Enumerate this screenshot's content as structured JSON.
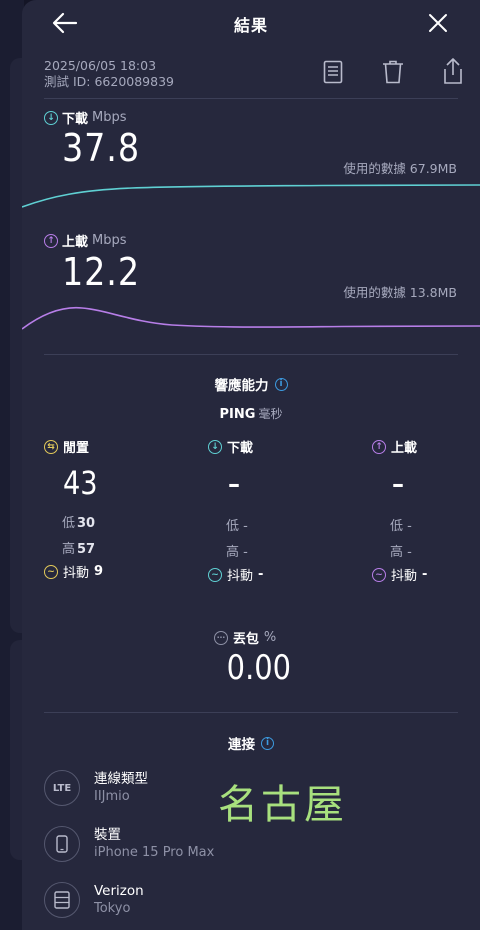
{
  "header": {
    "title": "結果",
    "back_icon": "arrow-left-icon",
    "close_icon": "close-icon"
  },
  "meta": {
    "datetime": "2025/06/05 18:03",
    "test_id": "測試 ID: 6620089839"
  },
  "toolbar": {
    "icons": [
      "document-icon",
      "trash-icon",
      "share-icon"
    ]
  },
  "download": {
    "label": "下載",
    "unit": "Mbps",
    "value": "37.8",
    "used": "使用的數據 67.9MB",
    "color": "#5fd0d3"
  },
  "upload": {
    "label": "上載",
    "unit": "Mbps",
    "value": "12.2",
    "used": "使用的數據 13.8MB",
    "color": "#b77ee8"
  },
  "responsiveness": {
    "title": "響應能力",
    "ping_label": "PING",
    "ping_unit": "毫秒",
    "columns": [
      {
        "label": "閒置",
        "value": "43",
        "low_label": "低",
        "low": "30",
        "high_label": "高",
        "high": "57",
        "jitter_label": "抖動",
        "jitter": "9",
        "color": "#e2c95a"
      },
      {
        "label": "下載",
        "value": "–",
        "low_label": "低",
        "low": "-",
        "high_label": "高",
        "high": "-",
        "jitter_label": "抖動",
        "jitter": "-",
        "color": "#5fd0d3"
      },
      {
        "label": "上載",
        "value": "–",
        "low_label": "低",
        "low": "-",
        "high_label": "高",
        "high": "-",
        "jitter_label": "抖動",
        "jitter": "-",
        "color": "#b77ee8"
      }
    ]
  },
  "packet_loss": {
    "label": "丟包",
    "unit": "%",
    "value": "0.00"
  },
  "connection": {
    "title": "連接",
    "items": [
      {
        "icon": "lte-icon",
        "icon_text": "LTE",
        "title": "連線類型",
        "sub": "IIJmio"
      },
      {
        "icon": "phone-icon",
        "title": "裝置",
        "sub": "iPhone 15 Pro Max"
      },
      {
        "icon": "server-icon",
        "title": "Verizon",
        "sub": "Tokyo"
      }
    ]
  },
  "overlay_text": "名古屋"
}
